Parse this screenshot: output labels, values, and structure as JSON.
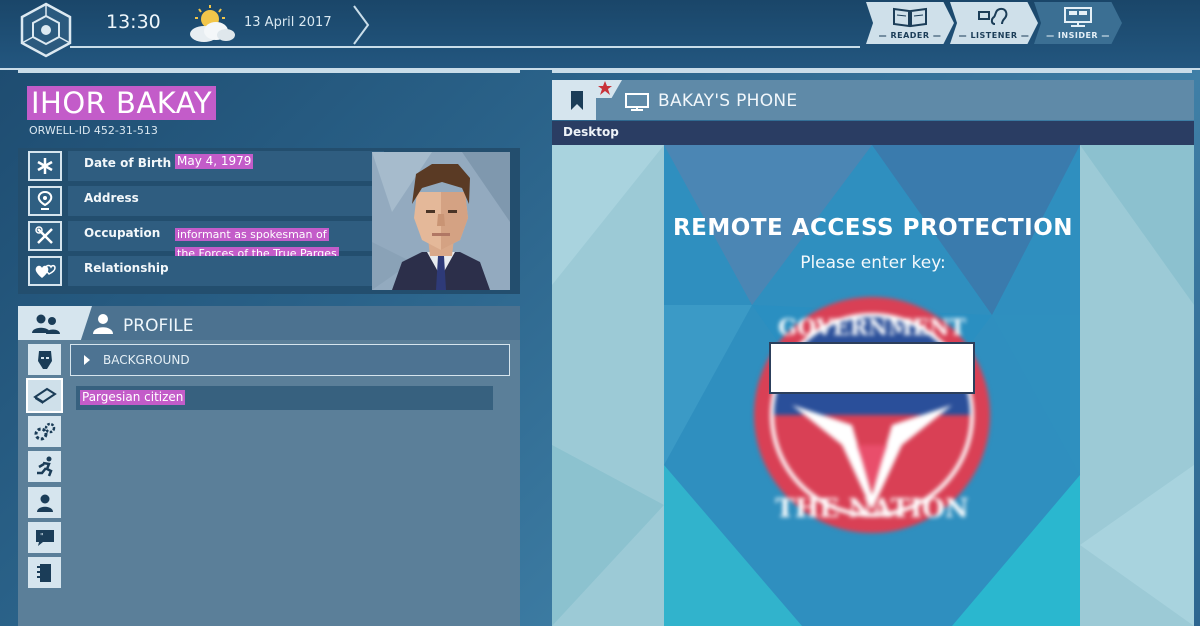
{
  "topbar": {
    "time": "13:30",
    "date": "13 April 2017",
    "modes": [
      {
        "label": "— READER —",
        "icon": "book-icon"
      },
      {
        "label": "— LISTENER —",
        "icon": "ear-icon"
      },
      {
        "label": "— INSIDER —",
        "icon": "monitor-icon"
      }
    ]
  },
  "person": {
    "name": "IHOR BAKAY",
    "orwell_id": "ORWELL-ID  452-31-513",
    "fields": [
      {
        "label": "Date of Birth",
        "value": "May 4, 1979",
        "icon": "asterisk-icon"
      },
      {
        "label": "Address",
        "value": "",
        "icon": "location-pin-icon"
      },
      {
        "label": "Occupation",
        "value_line1": "informant as spokesman of",
        "value_line2": "the Forces of the True Parges",
        "icon": "tools-icon"
      },
      {
        "label": "Relationship",
        "value": "",
        "icon": "hearts-icon"
      }
    ]
  },
  "profile": {
    "title": "PROFILE",
    "background_label": "BACKGROUND",
    "background_value": "Pargesian citizen"
  },
  "phone": {
    "title": "BAKAY'S PHONE",
    "section": "Desktop",
    "screen_title": "REMOTE ACCESS PROTECTION",
    "screen_prompt": "Please enter key:",
    "key_value": "",
    "seal_top_text": "GOVERNMENT",
    "seal_bottom_text": "THE NATION"
  },
  "colors": {
    "highlight": "#c35cc9",
    "panel_dark": "#234e6e",
    "panel_light": "#d6e5ee"
  }
}
